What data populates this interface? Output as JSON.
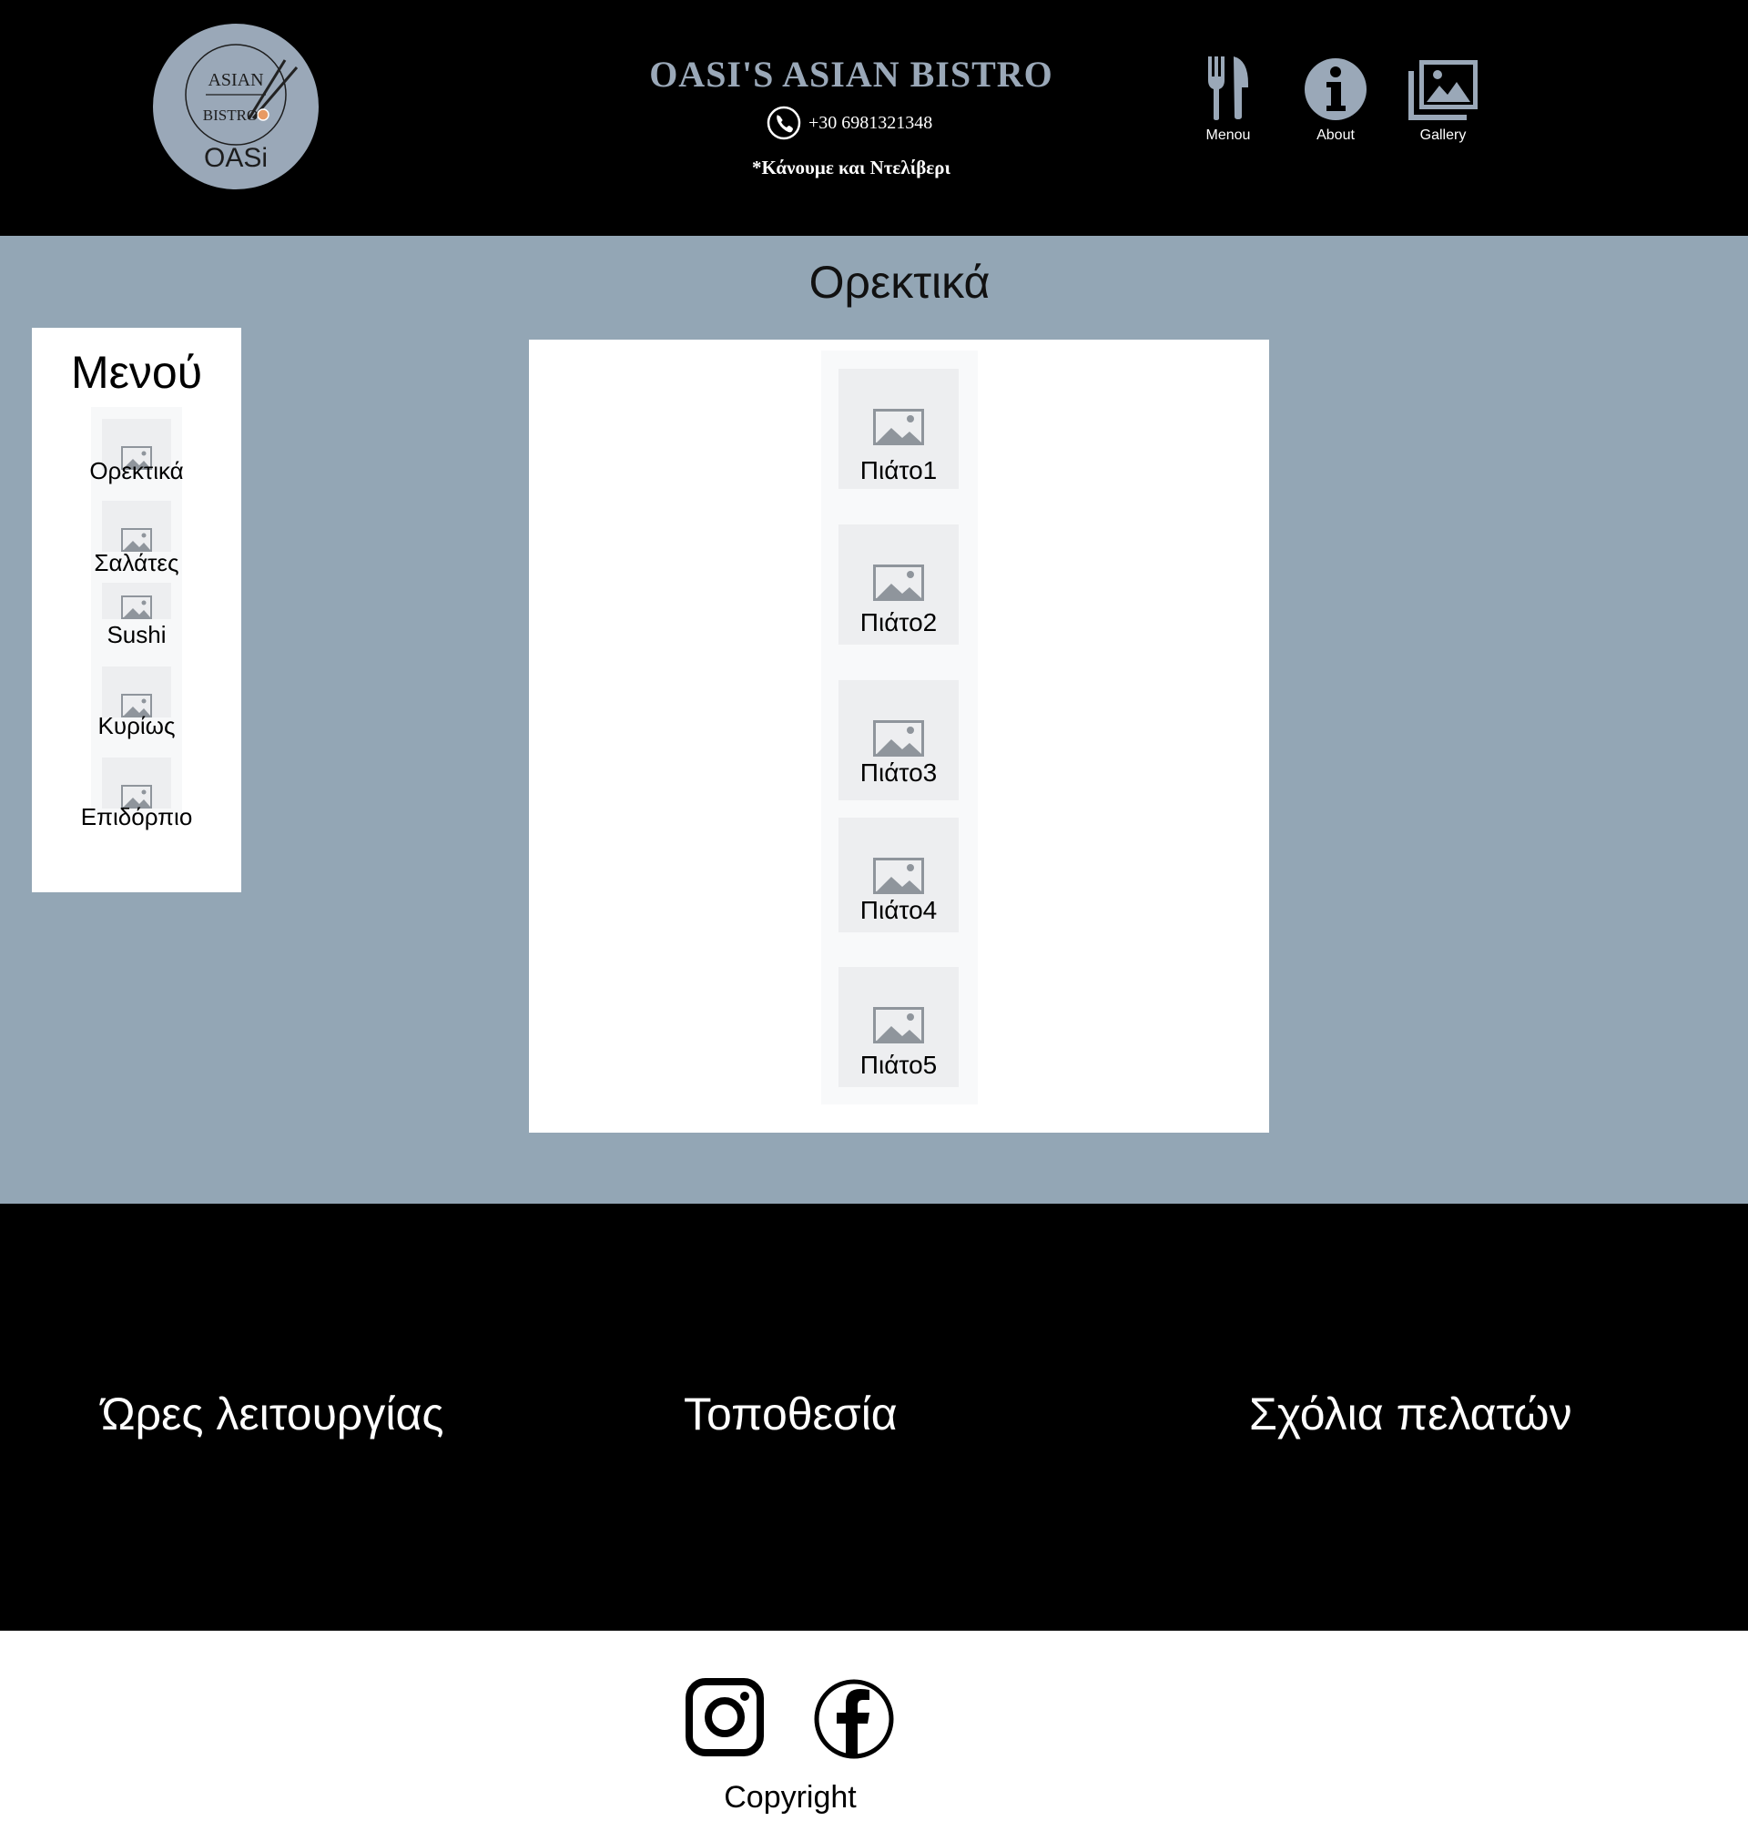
{
  "header": {
    "logo": {
      "line1": "ASIAN",
      "line2": "BISTRO",
      "line3": "OASi"
    },
    "brand_name": "OASI'S ASIAN BISTRO",
    "phone": "+30 6981321348",
    "delivery_note": "*Κάνουμε και Ντελίβερι",
    "nav": [
      {
        "label": "Menou",
        "icon": "fork-knife-icon"
      },
      {
        "label": "About",
        "icon": "info-icon"
      },
      {
        "label": "Gallery",
        "icon": "gallery-icon"
      }
    ]
  },
  "main": {
    "section_title": "Ορεκτικά",
    "sidebar": {
      "title": "Μενού",
      "items": [
        {
          "label": "Ορεκτικά"
        },
        {
          "label": "Σαλάτες"
        },
        {
          "label": "Sushi"
        },
        {
          "label": "Κυρίως"
        },
        {
          "label": "Επιδόρπιο"
        }
      ]
    },
    "dishes": [
      {
        "label": "Πιάτο1"
      },
      {
        "label": "Πιάτο2"
      },
      {
        "label": "Πιάτο3"
      },
      {
        "label": "Πιάτο4"
      },
      {
        "label": "Πιάτο5"
      }
    ]
  },
  "info": {
    "hours_title": "Ώρες λειτουργίας",
    "location_title": "Τοποθεσία",
    "reviews_title": "Σχόλια πελατών"
  },
  "footer": {
    "social": [
      {
        "icon": "instagram-icon"
      },
      {
        "icon": "facebook-icon"
      }
    ],
    "copyright": "Copyright"
  },
  "colors": {
    "header_bg": "#000000",
    "main_bg": "#93a6b5",
    "brand_text": "#9aa8b8",
    "placeholder_bg": "#edeef0",
    "placeholder_icon": "#8f959c"
  }
}
